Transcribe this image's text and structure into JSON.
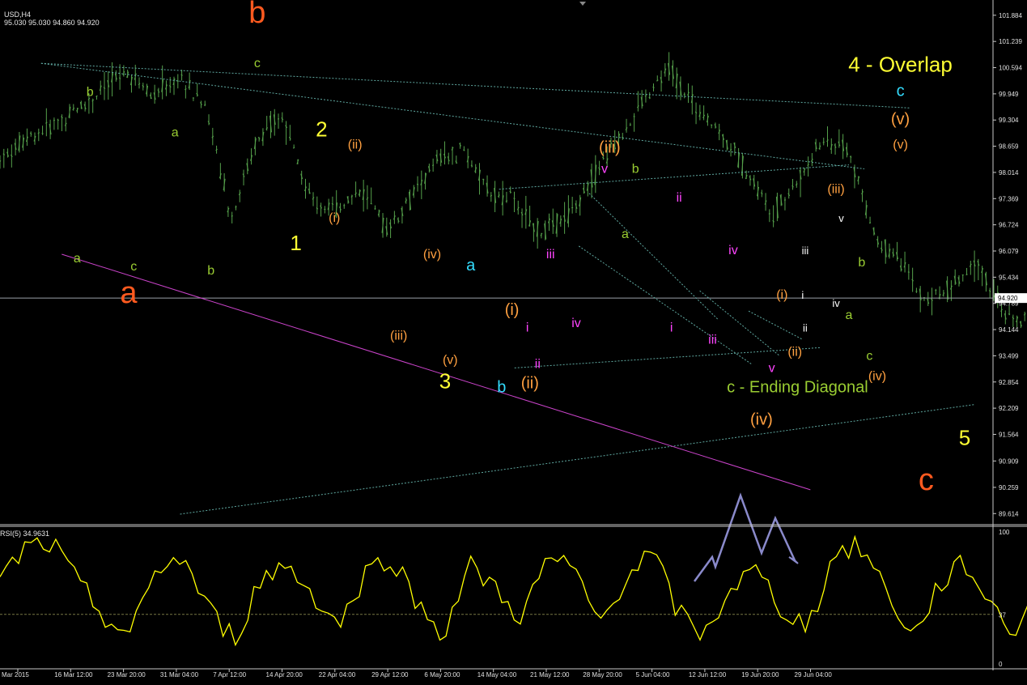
{
  "header": {
    "symbol_period": "USD,H4",
    "ohlc": "95.030 95.030 94.860 94.920"
  },
  "rsi": {
    "title": "RSI(5) 34.9631",
    "levels": [
      "100",
      "37",
      "0"
    ]
  },
  "colors": {
    "background": "#000000",
    "candles": "#55a04b",
    "rsi_line": "#ffff00",
    "channel_lines": "#5fa8a0",
    "magenta_line": "#cc44cc",
    "arrow": "#8a8acb",
    "price_line": "#9aa0a8"
  },
  "chart_data": {
    "type": "candlestick",
    "symbol_period": "USD,H4",
    "current_price": 94.92,
    "y_ticks": [
      "101.884",
      "101.239",
      "100.594",
      "99.949",
      "99.304",
      "98.659",
      "98.014",
      "97.369",
      "96.724",
      "96.079",
      "95.434",
      "94.789",
      "94.144",
      "93.499",
      "92.854",
      "92.209",
      "91.564",
      "90.909",
      "90.259",
      "89.614"
    ],
    "x_ticks": [
      "Mar 2015",
      "16 Mar 12:00",
      "23 Mar 20:00",
      "31 Mar 04:00",
      "7 Apr 12:00",
      "14 Apr 20:00",
      "22 Apr 04:00",
      "29 Apr 12:00",
      "6 May 20:00",
      "14 May 04:00",
      "21 May 12:00",
      "28 May 20:00",
      "5 Jun 04:00",
      "12 Jun 12:00",
      "19 Jun 20:00",
      "29 Jun 04:00"
    ],
    "ylim": [
      89.4,
      102.1
    ],
    "price_path": [
      [
        0,
        98.4
      ],
      [
        3,
        99.6
      ],
      [
        5,
        100.5
      ],
      [
        6,
        99.9
      ],
      [
        7,
        100.4
      ],
      [
        8,
        99.6
      ],
      [
        9,
        96.9
      ],
      [
        10,
        98.9
      ],
      [
        11,
        99.4
      ],
      [
        12,
        97.4
      ],
      [
        13,
        97.1
      ],
      [
        14,
        97.6
      ],
      [
        15,
        96.6
      ],
      [
        16,
        97.4
      ],
      [
        17,
        98.3
      ],
      [
        18,
        98.6
      ],
      [
        19,
        97.5
      ],
      [
        20,
        97.3
      ],
      [
        21,
        96.5
      ],
      [
        22,
        96.9
      ],
      [
        24,
        98.8
      ],
      [
        26,
        100.6
      ],
      [
        27,
        99.6
      ],
      [
        28,
        99.0
      ],
      [
        29,
        98.1
      ],
      [
        30,
        97.0
      ],
      [
        31,
        97.8
      ],
      [
        32,
        98.8
      ],
      [
        33,
        98.6
      ],
      [
        34,
        96.4
      ],
      [
        35,
        95.8
      ],
      [
        36,
        94.8
      ],
      [
        37,
        95.2
      ],
      [
        38,
        95.8
      ],
      [
        39,
        94.5
      ],
      [
        40,
        94.3
      ],
      [
        41,
        95.0
      ],
      [
        42,
        94.4
      ],
      [
        43,
        94.9
      ],
      [
        44,
        93.8
      ],
      [
        45,
        93.4
      ],
      [
        46,
        93.2
      ],
      [
        47,
        94.2
      ],
      [
        48,
        94.3
      ],
      [
        49,
        95.7
      ],
      [
        50,
        95.2
      ],
      [
        51,
        95.0
      ],
      [
        52,
        96.7
      ],
      [
        53,
        97.5
      ],
      [
        54,
        97.0
      ],
      [
        55,
        97.3
      ],
      [
        56,
        96.2
      ],
      [
        57,
        96.0
      ],
      [
        58,
        95.4
      ],
      [
        59,
        96.6
      ],
      [
        60,
        94.9
      ],
      [
        61,
        95.2
      ],
      [
        62,
        95.1
      ],
      [
        63,
        94.8
      ],
      [
        64,
        94.6
      ],
      [
        65,
        93.9
      ],
      [
        66,
        94.6
      ],
      [
        67,
        95.8
      ],
      [
        68,
        95.9
      ],
      [
        69,
        95.1
      ],
      [
        70,
        96.7
      ],
      [
        71,
        95.4
      ],
      [
        72,
        94.9
      ]
    ],
    "rsi": {
      "ylim": [
        0,
        100
      ],
      "level": 37,
      "values": [
        62,
        88,
        90,
        60,
        35,
        20,
        72,
        80,
        40,
        18,
        64,
        75,
        52,
        28,
        68,
        82,
        45,
        22,
        74,
        56,
        34,
        80,
        70,
        30,
        66,
        84,
        38,
        20,
        58,
        70,
        40,
        28,
        84,
        88,
        55,
        18,
        60,
        76,
        44,
        22,
        88,
        80,
        70,
        52,
        40,
        60,
        42,
        26,
        62,
        70,
        55,
        82,
        48,
        34,
        64,
        54,
        90,
        70,
        88,
        60,
        42,
        66,
        48,
        34,
        90,
        76,
        62,
        55,
        40,
        78,
        24,
        34
      ]
    },
    "wave_labels": [
      {
        "text": "b",
        "color": "#ff5a1f",
        "x": 10,
        "y": 101.7,
        "size": "xl"
      },
      {
        "text": "a",
        "color": "#ff5a1f",
        "x": 5,
        "y": 94.8,
        "size": "xl"
      },
      {
        "text": "c",
        "color": "#ff5a1f",
        "x": 36,
        "y": 90.2,
        "size": "xl"
      },
      {
        "text": "c",
        "color": "#9acd32",
        "x": 10,
        "y": 100.6,
        "size": "sm"
      },
      {
        "text": "b",
        "color": "#9acd32",
        "x": 3.5,
        "y": 99.9,
        "size": "sm"
      },
      {
        "text": "a",
        "color": "#9acd32",
        "x": 3,
        "y": 95.8,
        "size": "sm"
      },
      {
        "text": "c",
        "color": "#9acd32",
        "x": 5.2,
        "y": 95.6,
        "size": "sm"
      },
      {
        "text": "a",
        "color": "#9acd32",
        "x": 6.8,
        "y": 98.9,
        "size": "sm"
      },
      {
        "text": "b",
        "color": "#9acd32",
        "x": 8.2,
        "y": 95.5,
        "size": "sm"
      },
      {
        "text": "1",
        "color": "#ffff33",
        "x": 11.5,
        "y": 96.1,
        "size": "lg"
      },
      {
        "text": "2",
        "color": "#ffff33",
        "x": 12.5,
        "y": 98.9,
        "size": "lg"
      },
      {
        "text": "3",
        "color": "#ffff33",
        "x": 17.3,
        "y": 92.7,
        "size": "lg"
      },
      {
        "text": "4 - Overlap",
        "color": "#ffff33",
        "x": 35,
        "y": 100.5,
        "size": "lg"
      },
      {
        "text": "5",
        "color": "#ffff33",
        "x": 37.5,
        "y": 91.3,
        "size": "lg"
      },
      {
        "text": "(ii)",
        "color": "#ffa040",
        "x": 13.8,
        "y": 98.6,
        "size": "sm"
      },
      {
        "text": "(i)",
        "color": "#ffa040",
        "x": 13,
        "y": 96.8,
        "size": "sm"
      },
      {
        "text": "(iii)",
        "color": "#ffa040",
        "x": 15.5,
        "y": 93.9,
        "size": "sm"
      },
      {
        "text": "(iv)",
        "color": "#ffa040",
        "x": 16.8,
        "y": 95.9,
        "size": "sm"
      },
      {
        "text": "(v)",
        "color": "#ffa040",
        "x": 17.5,
        "y": 93.3,
        "size": "sm"
      },
      {
        "text": "a",
        "color": "#33ddff",
        "x": 18.3,
        "y": 95.6,
        "size": "md"
      },
      {
        "text": "b",
        "color": "#33ddff",
        "x": 19.5,
        "y": 92.6,
        "size": "md"
      },
      {
        "text": "c",
        "color": "#33ddff",
        "x": 35,
        "y": 99.9,
        "size": "md"
      },
      {
        "text": "(i)",
        "color": "#ffa040",
        "x": 19.9,
        "y": 94.5,
        "size": "md"
      },
      {
        "text": "(ii)",
        "color": "#ffa040",
        "x": 20.6,
        "y": 92.7,
        "size": "md"
      },
      {
        "text": "(iii)",
        "color": "#ffa040",
        "x": 23.7,
        "y": 98.5,
        "size": "md"
      },
      {
        "text": "(iv)",
        "color": "#ffa040",
        "x": 29.6,
        "y": 91.8,
        "size": "md"
      },
      {
        "text": "(v)",
        "color": "#ffa040",
        "x": 35,
        "y": 99.2,
        "size": "md"
      },
      {
        "text": "(v)",
        "color": "#ffa040",
        "x": 35,
        "y": 98.6,
        "size": "sm"
      },
      {
        "text": "(iii)",
        "color": "#ffa040",
        "x": 32.5,
        "y": 97.5,
        "size": "sm"
      },
      {
        "text": "(i)",
        "color": "#ffa040",
        "x": 30.4,
        "y": 94.9,
        "size": "sm"
      },
      {
        "text": "(ii)",
        "color": "#ffa040",
        "x": 30.9,
        "y": 93.5,
        "size": "sm"
      },
      {
        "text": "(iv)",
        "color": "#ffa040",
        "x": 34.1,
        "y": 92.9,
        "size": "sm"
      },
      {
        "text": "i",
        "color": "#ff44ff",
        "x": 20.5,
        "y": 94.1,
        "size": "sm"
      },
      {
        "text": "ii",
        "color": "#ff44ff",
        "x": 20.9,
        "y": 93.2,
        "size": "sm"
      },
      {
        "text": "iii",
        "color": "#ff44ff",
        "x": 21.4,
        "y": 95.9,
        "size": "sm"
      },
      {
        "text": "iv",
        "color": "#ff44ff",
        "x": 22.4,
        "y": 94.2,
        "size": "sm"
      },
      {
        "text": "v",
        "color": "#ff44ff",
        "x": 23.5,
        "y": 98.0,
        "size": "sm"
      },
      {
        "text": "ii",
        "color": "#ff44ff",
        "x": 26.4,
        "y": 97.3,
        "size": "sm"
      },
      {
        "text": "iv",
        "color": "#ff44ff",
        "x": 28.5,
        "y": 96.0,
        "size": "sm"
      },
      {
        "text": "i",
        "color": "#ff44ff",
        "x": 26.1,
        "y": 94.1,
        "size": "sm"
      },
      {
        "text": "iii",
        "color": "#ff44ff",
        "x": 27.7,
        "y": 93.8,
        "size": "sm"
      },
      {
        "text": "v",
        "color": "#ff44ff",
        "x": 30,
        "y": 93.1,
        "size": "sm"
      },
      {
        "text": "b",
        "color": "#9acd32",
        "x": 24.7,
        "y": 98.0,
        "size": "sm"
      },
      {
        "text": "a",
        "color": "#9acd32",
        "x": 24.3,
        "y": 96.4,
        "size": "sm"
      },
      {
        "text": "iii",
        "color": "#ffffff",
        "x": 31.3,
        "y": 96.0,
        "size": "xs"
      },
      {
        "text": "i",
        "color": "#ffffff",
        "x": 31.2,
        "y": 94.9,
        "size": "xs"
      },
      {
        "text": "ii",
        "color": "#ffffff",
        "x": 31.3,
        "y": 94.1,
        "size": "xs"
      },
      {
        "text": "v",
        "color": "#ffffff",
        "x": 32.7,
        "y": 96.8,
        "size": "xs"
      },
      {
        "text": "iv",
        "color": "#ffffff",
        "x": 32.5,
        "y": 94.7,
        "size": "xs"
      },
      {
        "text": "b",
        "color": "#9acd32",
        "x": 33.5,
        "y": 95.7,
        "size": "sm"
      },
      {
        "text": "a",
        "color": "#9acd32",
        "x": 33,
        "y": 94.4,
        "size": "sm"
      },
      {
        "text": "c",
        "color": "#9acd32",
        "x": 33.8,
        "y": 93.4,
        "size": "sm"
      },
      {
        "text": "c - Ending Diagonal",
        "color": "#9acd32",
        "x": 31,
        "y": 92.6,
        "size": "md"
      }
    ]
  }
}
